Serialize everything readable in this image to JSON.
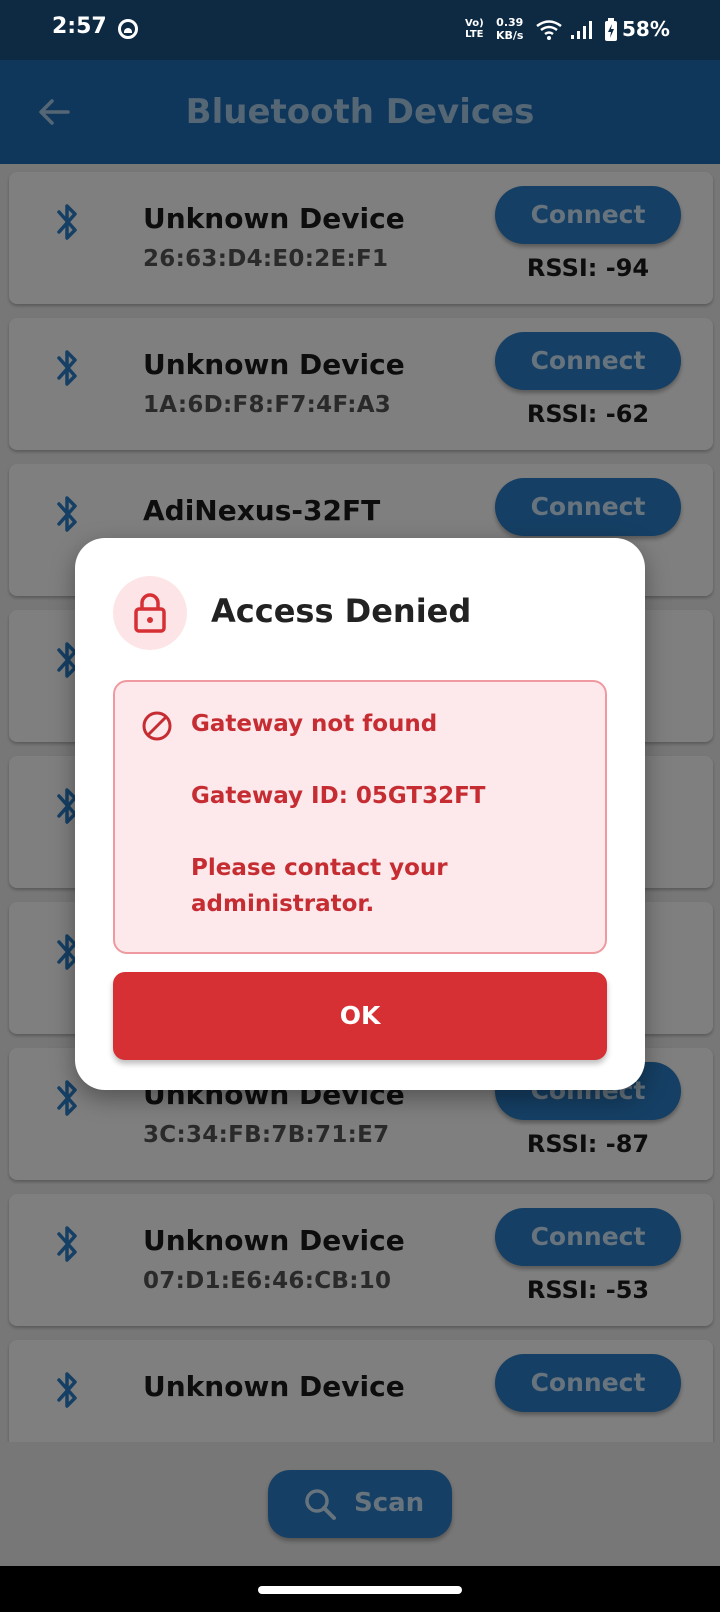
{
  "status_bar": {
    "time": "2:57",
    "volte_line1": "Vo)",
    "volte_line2": "LTE",
    "net_speed_value": "0.39",
    "net_speed_unit": "KB/s",
    "battery_percent": "58%"
  },
  "app_bar": {
    "title": "Bluetooth Devices",
    "back_icon": "arrow-left-icon"
  },
  "devices": [
    {
      "name": "Unknown Device",
      "mac": "26:63:D4:E0:2E:F1",
      "rssi": "RSSI: -94",
      "button": "Connect"
    },
    {
      "name": "Unknown Device",
      "mac": "1A:6D:F8:F7:4F:A3",
      "rssi": "RSSI: -62",
      "button": "Connect"
    },
    {
      "name": "AdiNexus-32FT",
      "mac": "",
      "rssi": "",
      "button": "Connect"
    },
    {
      "name": "",
      "mac": "",
      "rssi": "",
      "button": ""
    },
    {
      "name": "",
      "mac": "",
      "rssi": "",
      "button": ""
    },
    {
      "name": "",
      "mac": "",
      "rssi": "",
      "button": ""
    },
    {
      "name": "Unknown Device",
      "mac": "3C:34:FB:7B:71:E7",
      "rssi": "RSSI: -87",
      "button": "Connect"
    },
    {
      "name": "Unknown Device",
      "mac": "07:D1:E6:46:CB:10",
      "rssi": "RSSI: -53",
      "button": "Connect"
    },
    {
      "name": "Unknown Device",
      "mac": "",
      "rssi": "",
      "button": "Connect"
    }
  ],
  "scan_button": {
    "label": "Scan",
    "icon": "search-icon"
  },
  "dialog": {
    "title": "Access Denied",
    "icon": "lock-icon",
    "error_icon": "ban-icon",
    "message_line1": "Gateway not found",
    "message_line2": "Gateway ID: 05GT32FT",
    "message_line3": "Please contact your administrator.",
    "ok_label": "OK"
  },
  "colors": {
    "primary": "#1e6fb8",
    "error": "#d62f34",
    "error_bg": "#fde9eb"
  }
}
